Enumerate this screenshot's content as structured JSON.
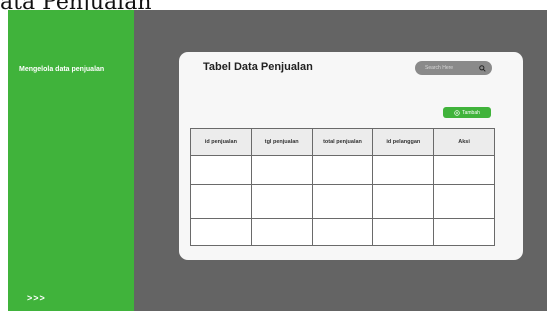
{
  "caption": "ata Penjualan",
  "sidebar": {
    "title": "Mengelola data penjualan",
    "footer_arrows": ">>>"
  },
  "card": {
    "title": "Tabel Data Penjualan",
    "search": {
      "placeholder": "Search Here",
      "icon": "search-icon"
    },
    "add_button": {
      "label": "Tambah",
      "icon": "plus-circle-icon"
    }
  },
  "table": {
    "columns": [
      "id penjualan",
      "tgl penjualan",
      "total penjualan",
      "id pelanggan",
      "Aksi"
    ],
    "rows": [
      [
        "",
        "",
        "",
        "",
        ""
      ],
      [
        "",
        "",
        "",
        "",
        ""
      ],
      [
        "",
        "",
        "",
        "",
        ""
      ]
    ]
  },
  "colors": {
    "sidebar_green": "#40b33b",
    "background_gray": "#646464",
    "card_bg": "#f7f7f7",
    "search_bg": "#8a8a8a"
  }
}
